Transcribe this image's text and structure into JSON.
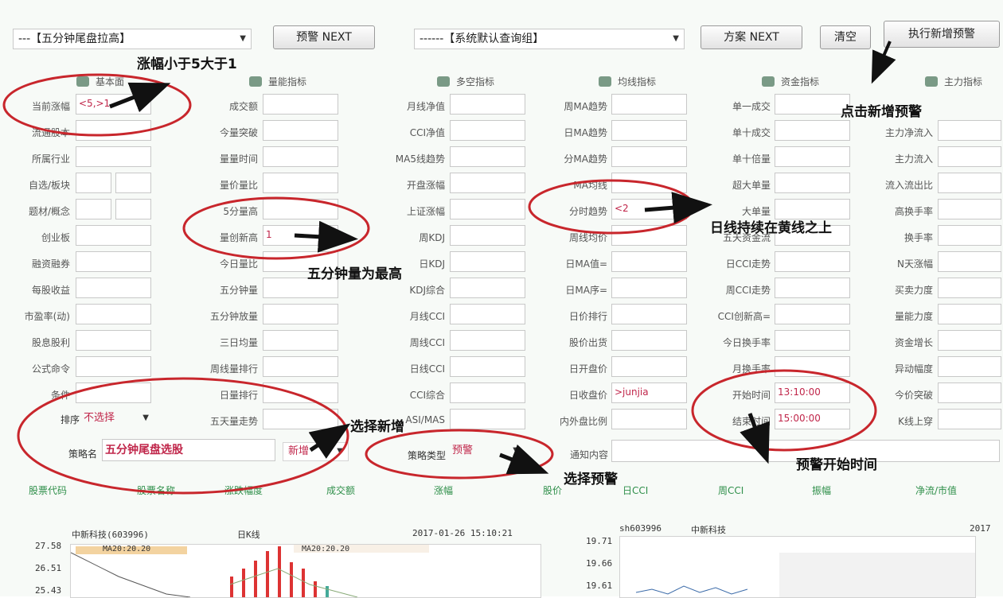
{
  "toolbar": {
    "strategy_combo": "---【五分钟尾盘拉高】",
    "prev_btn": "预警 NEXT",
    "system_combo": "------【系统默认查询组】",
    "plan_btn": "方案 NEXT",
    "clear_btn": "清空",
    "new_alert_btn": "执行新增预警"
  },
  "groups": [
    "基本面",
    "量能指标",
    "多空指标",
    "均线指标",
    "资金指标",
    "主力指标"
  ],
  "col1": {
    "labels": [
      "当前涨幅",
      "流通股本",
      "所属行业",
      "自选/板块",
      "题材/概念",
      "创业板",
      "融资融券",
      "每股收益",
      "市盈率(动)",
      "股息股利",
      "公式命令",
      "条件"
    ],
    "increase_value": "<5,>1"
  },
  "col2": {
    "labels": [
      "成交额",
      "今量突破",
      "量量时间",
      "量价量比",
      "5分量高",
      "量创新高",
      "今日量比",
      "五分钟量",
      "五分钟放量",
      "三日均量",
      "周线量排行",
      "日量排行",
      "五天量走势"
    ],
    "volume_value": "1"
  },
  "col3": {
    "labels": [
      "月线净值",
      "CCI净值",
      "MA5线趋势",
      "开盘涨幅",
      "上证涨幅",
      "周KDJ",
      "日KDJ",
      "KDJ综合",
      "月线CCI",
      "周线CCI",
      "日线CCI",
      "CCI综合",
      "ASI/MAS"
    ]
  },
  "col4": {
    "labels": [
      "周MA趋势",
      "日MA趋势",
      "分MA趋势",
      "MA均线",
      "分时趋势",
      "周线均价",
      "日MA值=",
      "日MA序=",
      "日价排行",
      "股价出货",
      "日开盘价",
      "日收盘价",
      "内外盘比例"
    ],
    "trend_value": "<2",
    "close_value": ">junjia"
  },
  "col5": {
    "labels": [
      "单一成交",
      "单十成交",
      "单十倍量",
      "超大单量",
      "大单量",
      "五天资金流",
      "日CCI走势",
      "周CCI走势",
      "CCI创新高=",
      "今日换手率",
      "月换手率",
      "开始时间",
      "结束时间"
    ],
    "start_time": "13:10:00",
    "end_time": "15:00:00"
  },
  "col6": {
    "labels": [
      "主力净流入",
      "主力流入",
      "流入流出比",
      "高换手率",
      "换手率",
      "N天涨幅",
      "买卖力度",
      "量能力度",
      "资金增长",
      "异动幅度",
      "今价突破",
      "K线上穿"
    ]
  },
  "bottom": {
    "sort_label": "排序",
    "sort_value": "不选择",
    "strategy_name_label": "策略名",
    "strategy_name_value": "五分钟尾盘选股",
    "new_label": "新增",
    "strategy_type_label": "策略类型",
    "strategy_type_value": "预警",
    "alert_content_label": "通知内容"
  },
  "annotations": {
    "a1": "涨幅小于5大于1",
    "a2": "点击新增预警",
    "a3": "日线持续在黄线之上",
    "a4": "五分钟量为最高",
    "a5": "选择新增",
    "a6": "选择预警",
    "a7": "预警开始时间"
  },
  "tabs": [
    "股票代码",
    "股票名称",
    "涨跌幅度",
    "成交额",
    "涨幅",
    "股价",
    "日CCI",
    "周CCI",
    "振幅",
    "净流/市值"
  ],
  "chart_left": {
    "name": "中新科技(603996)",
    "period": "日K线",
    "datetime": "2017-01-26 15:10:21",
    "ma_label_1": "MA20:20.20",
    "ma_label_2": "MA20:20.20",
    "y1": "27.58",
    "y2": "26.51",
    "y3": "25.43"
  },
  "chart_right": {
    "code": "sh603996",
    "name": "中新科技",
    "year": "2017",
    "y1": "19.71",
    "y2": "19.66",
    "y3": "19.61"
  }
}
